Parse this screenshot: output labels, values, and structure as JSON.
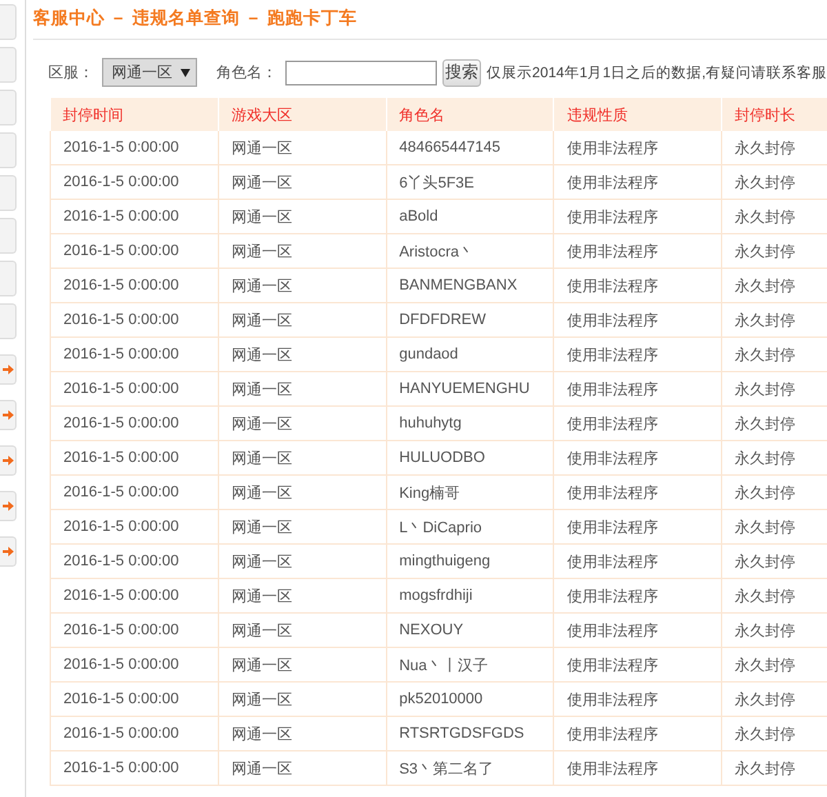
{
  "sidebar": {
    "tabs": [
      {
        "kind": "plain"
      },
      {
        "kind": "plain"
      },
      {
        "kind": "plain"
      },
      {
        "kind": "plain"
      },
      {
        "kind": "plain"
      },
      {
        "kind": "plain"
      },
      {
        "kind": "plain"
      },
      {
        "kind": "plain"
      },
      {
        "kind": "arrow"
      },
      {
        "kind": "arrow"
      },
      {
        "kind": "arrow"
      },
      {
        "kind": "arrow"
      },
      {
        "kind": "arrow"
      }
    ]
  },
  "breadcrumb": "客服中心 － 违规名单查询 － 跑跑卡丁车",
  "search": {
    "server_label": "区服：",
    "server_value": "网通一区",
    "name_label": "角色名：",
    "button": "搜索",
    "note": "仅展示2014年1月1日之后的数据,有疑问请联系客服"
  },
  "table": {
    "columns": [
      "封停时间",
      "游戏大区",
      "角色名",
      "违规性质",
      "封停时长"
    ],
    "rows": [
      [
        "2016-1-5 0:00:00",
        "网通一区",
        "484665447145",
        "使用非法程序",
        "永久封停"
      ],
      [
        "2016-1-5 0:00:00",
        "网通一区",
        "6丫头5F3E",
        "使用非法程序",
        "永久封停"
      ],
      [
        "2016-1-5 0:00:00",
        "网通一区",
        "aBold",
        "使用非法程序",
        "永久封停"
      ],
      [
        "2016-1-5 0:00:00",
        "网通一区",
        "Aristocra丶",
        "使用非法程序",
        "永久封停"
      ],
      [
        "2016-1-5 0:00:00",
        "网通一区",
        "BANMENGBANX",
        "使用非法程序",
        "永久封停"
      ],
      [
        "2016-1-5 0:00:00",
        "网通一区",
        "DFDFDREW",
        "使用非法程序",
        "永久封停"
      ],
      [
        "2016-1-5 0:00:00",
        "网通一区",
        "gundaod",
        "使用非法程序",
        "永久封停"
      ],
      [
        "2016-1-5 0:00:00",
        "网通一区",
        "HANYUEMENGHU",
        "使用非法程序",
        "永久封停"
      ],
      [
        "2016-1-5 0:00:00",
        "网通一区",
        "huhuhytg",
        "使用非法程序",
        "永久封停"
      ],
      [
        "2016-1-5 0:00:00",
        "网通一区",
        "HULUODBO",
        "使用非法程序",
        "永久封停"
      ],
      [
        "2016-1-5 0:00:00",
        "网通一区",
        "King楠哥",
        "使用非法程序",
        "永久封停"
      ],
      [
        "2016-1-5 0:00:00",
        "网通一区",
        "L丶DiCaprio",
        "使用非法程序",
        "永久封停"
      ],
      [
        "2016-1-5 0:00:00",
        "网通一区",
        "mingthuigeng",
        "使用非法程序",
        "永久封停"
      ],
      [
        "2016-1-5 0:00:00",
        "网通一区",
        "mogsfrdhiji",
        "使用非法程序",
        "永久封停"
      ],
      [
        "2016-1-5 0:00:00",
        "网通一区",
        "NEXOUY",
        "使用非法程序",
        "永久封停"
      ],
      [
        "2016-1-5 0:00:00",
        "网通一区",
        "Nua丶丨汉子",
        "使用非法程序",
        "永久封停"
      ],
      [
        "2016-1-5 0:00:00",
        "网通一区",
        "pk52010000",
        "使用非法程序",
        "永久封停"
      ],
      [
        "2016-1-5 0:00:00",
        "网通一区",
        "RTSRTGDSFGDS",
        "使用非法程序",
        "永久封停"
      ],
      [
        "2016-1-5 0:00:00",
        "网通一区",
        "S3丶第二名了",
        "使用非法程序",
        "永久封停"
      ]
    ]
  }
}
